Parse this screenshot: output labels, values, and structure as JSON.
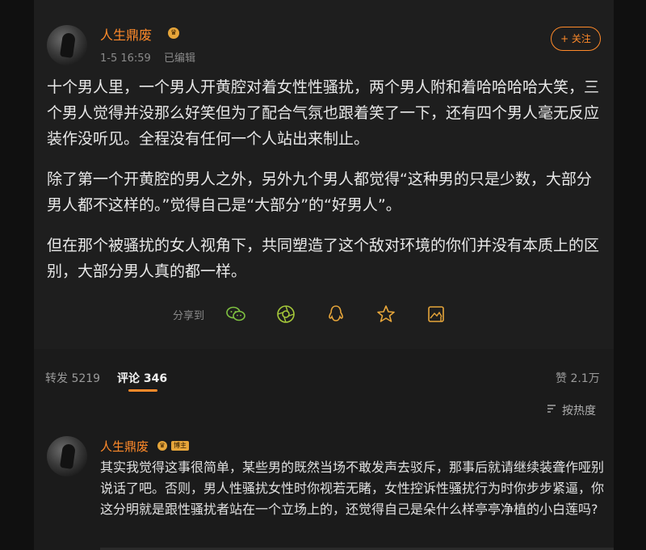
{
  "post": {
    "author": "人生鼎废",
    "time": "1-5 16:59",
    "edited": "已编辑",
    "follow": "+ 关注",
    "paragraphs": [
      "十个男人里，一个男人开黄腔对着女性性骚扰，两个男人附和着哈哈哈哈大笑，三个男人觉得并没那么好笑但为了配合气氛也跟着笑了一下，还有四个男人毫无反应装作没听见。全程没有任何一个人站出来制止。",
      "除了第一个开黄腔的男人之外，另外九个男人都觉得“这种男的只是少数，大部分男人都不这样的。”觉得自己是“大部分”的“好男人”。",
      "但在那个被骚扰的女人视角下，共同塑造了这个敌对环境的你们并没有本质上的区别，大部分男人真的都一样。"
    ],
    "share_label": "分享到",
    "share_icons": [
      "wechat-icon",
      "moments-icon",
      "qq-icon",
      "qzone-icon",
      "save-image-icon"
    ]
  },
  "stats": {
    "repost": "转发 5219",
    "comments": "评论 346",
    "likes": "赞 2.1万"
  },
  "sort": {
    "label": "按热度"
  },
  "comment": {
    "author": "人生鼎废",
    "badge": "博主",
    "text": "其实我觉得这事很简单，某些男的既然当场不敢发声去驳斥，那事后就请继续装聋作哑别说话了吧。否则，男人性骚扰女性时你视若无睹，女性控诉性骚扰行为时你步步紧逼，你这分明就是跟性骚扰者站在一个立场上的，还觉得自己是朵什么样亭亭净植的小白莲吗?"
  },
  "colors": {
    "accent": "#ff8a2a",
    "background": "#1e1e1e",
    "icon_green": "#7fc241",
    "icon_yellow": "#e6a53a"
  }
}
